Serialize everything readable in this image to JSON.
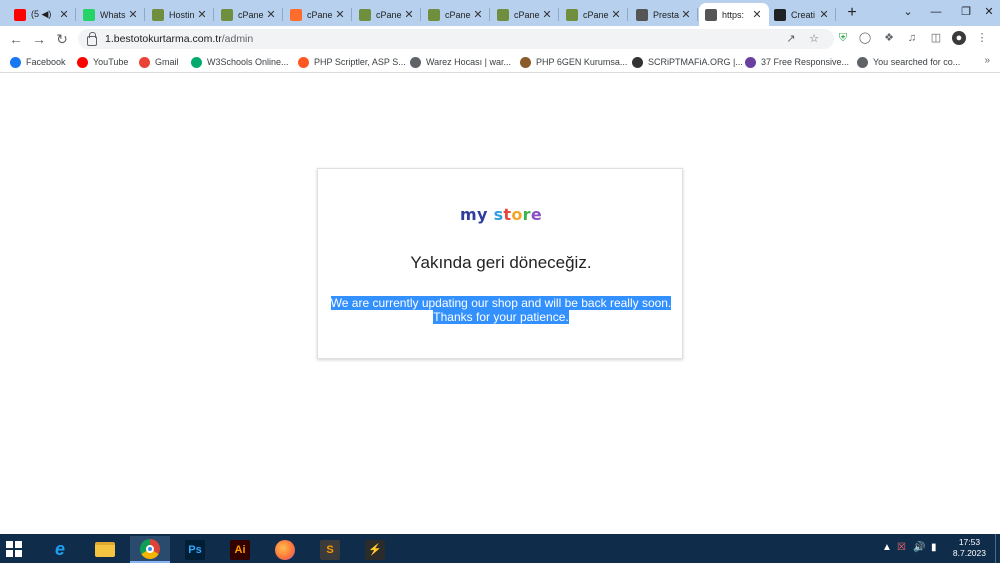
{
  "browser": {
    "tabs": [
      {
        "title": "(5 ◀)",
        "icon": "youtube-icon",
        "color": "#ff0000"
      },
      {
        "title": "Whats",
        "icon": "whatsapp-icon",
        "color": "#25d366"
      },
      {
        "title": "Hostin",
        "icon": "cpanel-shield-icon",
        "color": "#6f8f3f"
      },
      {
        "title": "cPane",
        "icon": "cpanel-shield-icon",
        "color": "#6f8f3f"
      },
      {
        "title": "cPane",
        "icon": "cpanel-logo-icon",
        "color": "#ff6c2c"
      },
      {
        "title": "cPane",
        "icon": "cpanel-shield-icon",
        "color": "#6f8f3f"
      },
      {
        "title": "cPane",
        "icon": "cpanel-shield-icon",
        "color": "#6f8f3f"
      },
      {
        "title": "cPane",
        "icon": "cpanel-shield-icon",
        "color": "#6f8f3f"
      },
      {
        "title": "cPane",
        "icon": "cpanel-shield-icon",
        "color": "#6f8f3f"
      },
      {
        "title": "Presta",
        "icon": "prestashop-icon",
        "color": "#555555"
      },
      {
        "title": "https:",
        "icon": "prestashop-icon",
        "color": "#555555",
        "active": true
      },
      {
        "title": "Creati",
        "icon": "p-letter-icon",
        "color": "#202124"
      }
    ],
    "url_host": "1.bestotokurtarma.com.tr",
    "url_path": "/admin",
    "bookmarks": [
      {
        "label": "Facebook",
        "icon": "facebook-icon",
        "color": "#1877f2"
      },
      {
        "label": "YouTube",
        "icon": "youtube-icon",
        "color": "#ff0000"
      },
      {
        "label": "Gmail",
        "icon": "gmail-icon",
        "color": "#ea4335"
      },
      {
        "label": "W3Schools Online...",
        "icon": "w3schools-icon",
        "color": "#04aa6d"
      },
      {
        "label": "PHP Scriptler, ASP S...",
        "icon": "blogger-icon",
        "color": "#ff5722"
      },
      {
        "label": "Warez Hocası | war...",
        "icon": "globe-icon",
        "color": "#5f6368"
      },
      {
        "label": "PHP 6GEN Kurumsa...",
        "icon": "php6gen-icon",
        "color": "#8b5a2b"
      },
      {
        "label": "SCRiPTMAFiA.ORG |...",
        "icon": "skull-icon",
        "color": "#333333"
      },
      {
        "label": "37 Free Responsive...",
        "icon": "template-icon",
        "color": "#6a3fa0"
      },
      {
        "label": "You searched for co...",
        "icon": "globe-icon",
        "color": "#5f6368"
      }
    ]
  },
  "page": {
    "logo_my": "my",
    "logo_store": [
      "s",
      "t",
      "o",
      "r",
      "e"
    ],
    "headline": "Yakında geri döneceğiz.",
    "message_line1": "We are currently updating our shop and will be back really soon.",
    "message_line2": "Thanks for your patience."
  },
  "taskbar": {
    "apps": [
      {
        "name": "internet-explorer-icon",
        "label": "e",
        "color": "#1ea0f0",
        "bg": "transparent"
      },
      {
        "name": "file-explorer-icon",
        "label": "",
        "color": "#f5c542",
        "bg": "#f5c542"
      },
      {
        "name": "chrome-icon",
        "label": "",
        "color": "#db4437",
        "bg": "transparent",
        "active": true
      },
      {
        "name": "photoshop-icon",
        "label": "Ps",
        "color": "#31a8ff",
        "bg": "#001e36"
      },
      {
        "name": "illustrator-icon",
        "label": "Ai",
        "color": "#ff9a00",
        "bg": "#330000"
      },
      {
        "name": "firefox-icon",
        "label": "",
        "color": "#ff7139",
        "bg": "transparent"
      },
      {
        "name": "sublime-icon",
        "label": "S",
        "color": "#ff9800",
        "bg": "#3b3b3b"
      },
      {
        "name": "winamp-icon",
        "label": "⚡",
        "color": "#e8c12a",
        "bg": "#2b2b2b"
      }
    ],
    "time": "17:53",
    "date": "8.7.2023"
  }
}
